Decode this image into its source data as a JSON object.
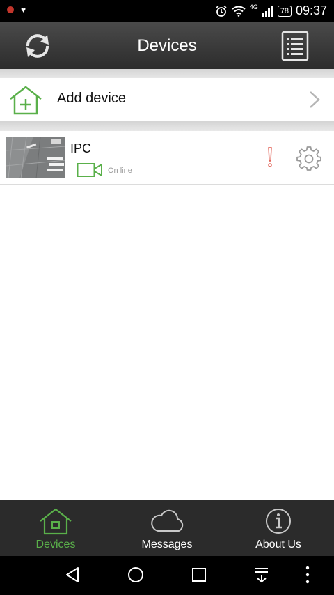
{
  "status_bar": {
    "network": "4G",
    "battery": "78",
    "time": "09:37"
  },
  "header": {
    "title": "Devices",
    "refresh_icon": "refresh-icon",
    "list_icon": "list-icon"
  },
  "add_device": {
    "label": "Add device",
    "icon": "add-home-icon"
  },
  "devices": [
    {
      "name": "IPC",
      "status": "On line",
      "status_icon": "video-camera-icon",
      "alert_icon": "exclamation-icon",
      "settings_icon": "gear-icon"
    }
  ],
  "bottom_nav": {
    "tabs": [
      {
        "label": "Devices",
        "icon": "home-icon",
        "active": true
      },
      {
        "label": "Messages",
        "icon": "cloud-icon",
        "active": false
      },
      {
        "label": "About Us",
        "icon": "info-icon",
        "active": false
      }
    ]
  },
  "colors": {
    "accent_green": "#5ab04a",
    "alert_red": "#e05a4e",
    "header_dark": "#333333"
  }
}
